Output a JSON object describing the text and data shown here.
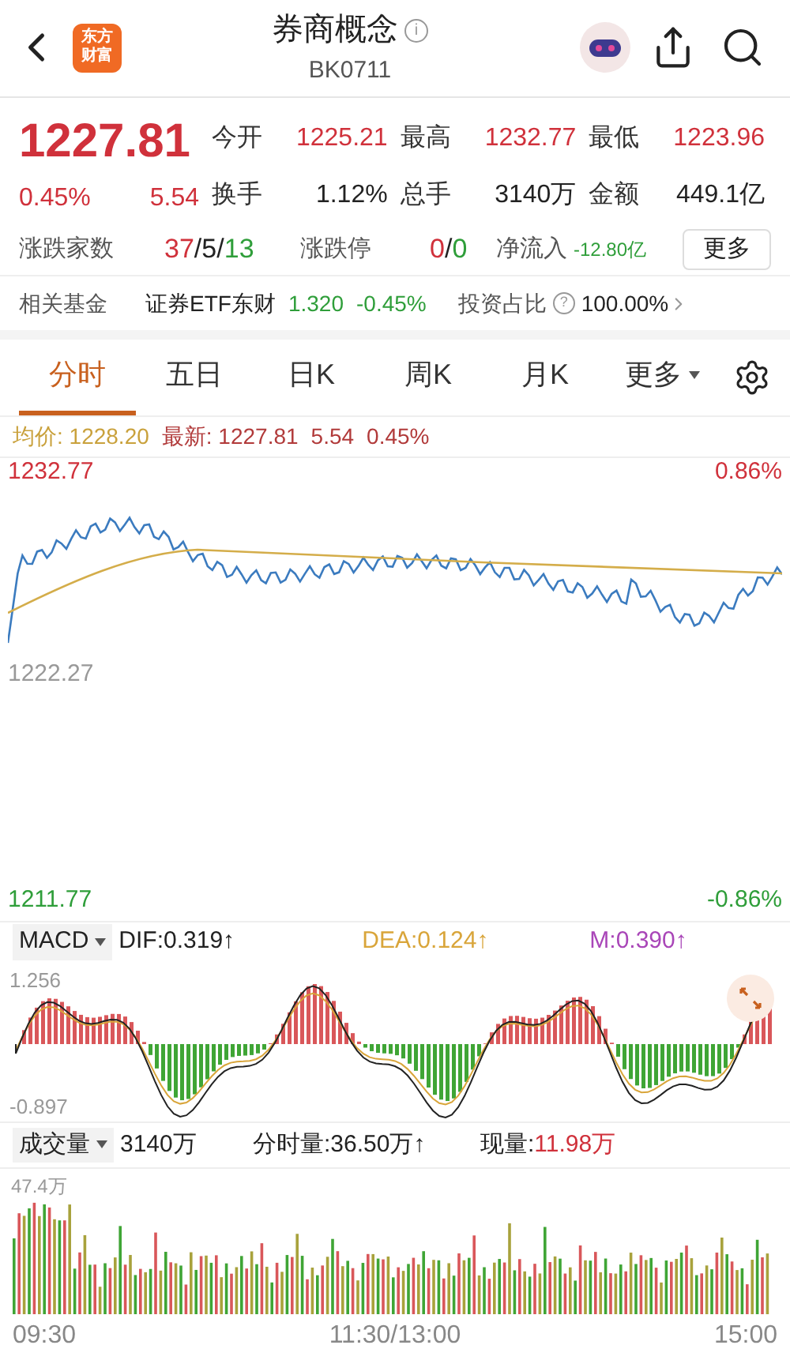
{
  "header": {
    "logo_lines": [
      "东方",
      "财富"
    ],
    "title": "券商概念",
    "info_mark": "i",
    "code": "BK0711"
  },
  "quote": {
    "price": "1227.81",
    "change_pct": "0.45%",
    "change": "5.54",
    "stats": [
      {
        "label": "今开",
        "value": "1225.21",
        "kind": "red"
      },
      {
        "label": "最高",
        "value": "1232.77",
        "kind": "red"
      },
      {
        "label": "最低",
        "value": "1223.96",
        "kind": "red"
      },
      {
        "label": "换手",
        "value": "1.12%",
        "kind": "plain"
      },
      {
        "label": "总手",
        "value": "3140万",
        "kind": "plain"
      },
      {
        "label": "金额",
        "value": "449.1亿",
        "kind": "plain"
      }
    ],
    "breadth_label": "涨跌家数",
    "breadth": [
      "37",
      "5",
      "13"
    ],
    "limit_label": "涨跌停",
    "limit": [
      "0",
      "0"
    ],
    "separator": "/",
    "inflow_label": "净流入",
    "inflow": "-12.80亿",
    "more": "更多"
  },
  "fund": {
    "label": "相关基金",
    "name": "证券ETF东财",
    "price": "1.320",
    "change": "-0.45%",
    "share_label": "投资占比",
    "help": "?",
    "share": "100.00%"
  },
  "tabs": [
    {
      "label": "分时",
      "selected": true
    },
    {
      "label": "五日",
      "selected": false
    },
    {
      "label": "日K",
      "selected": false
    },
    {
      "label": "周K",
      "selected": false
    },
    {
      "label": "月K",
      "selected": false
    },
    {
      "label": "更多",
      "selected": false
    }
  ],
  "summary": {
    "avg_label": "均价:",
    "avg": "1228.20",
    "latest_label": "最新:",
    "latest": "1227.81",
    "change": "5.54",
    "pct": "0.45%"
  },
  "price_chart": {
    "y_high": "1232.77",
    "y_mid": "1222.27",
    "y_low": "1211.77",
    "pct_high": "0.86%",
    "pct_low": "-0.86%"
  },
  "macd": {
    "selector": "MACD",
    "dif": "DIF:0.319",
    "dea": "DEA:0.124",
    "m": "M:0.390",
    "arrow": "↑",
    "y_high": "1.256",
    "y_low": "-0.897"
  },
  "volume": {
    "selector": "成交量",
    "total": "3140万",
    "minute": "分时量:36.50万",
    "arrow": "↑",
    "now_label": "现量:",
    "now": "11.98万",
    "y_high": "47.4万"
  },
  "times": [
    "09:30",
    "11:30/13:00",
    "15:00"
  ]
}
